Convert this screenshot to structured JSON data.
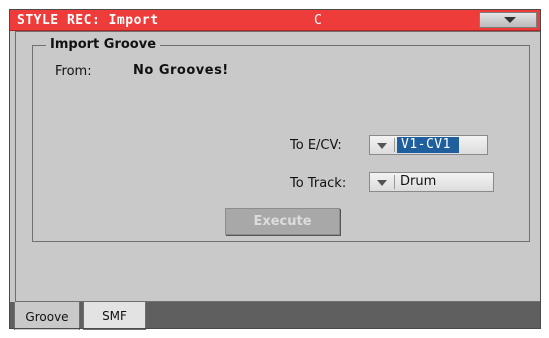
{
  "title_bar": {
    "title": "STYLE REC: Import",
    "key": "C"
  },
  "group": {
    "title": "Import Groove"
  },
  "from": {
    "label": "From:",
    "value": "No Grooves!"
  },
  "to_ecv": {
    "label": "To E/CV:",
    "value": "V1-CV1"
  },
  "to_track": {
    "label": "To Track:",
    "value": "Drum"
  },
  "execute": {
    "label": "Execute",
    "enabled": false
  },
  "tabs": [
    {
      "label": "Groove",
      "active": true
    },
    {
      "label": "SMF",
      "active": false
    }
  ],
  "colors": {
    "title_bar": "#ee3c3a",
    "selection": "#1f5f9e",
    "panel": "#c9c9c9",
    "tab_bar": "#5f5f5f"
  }
}
